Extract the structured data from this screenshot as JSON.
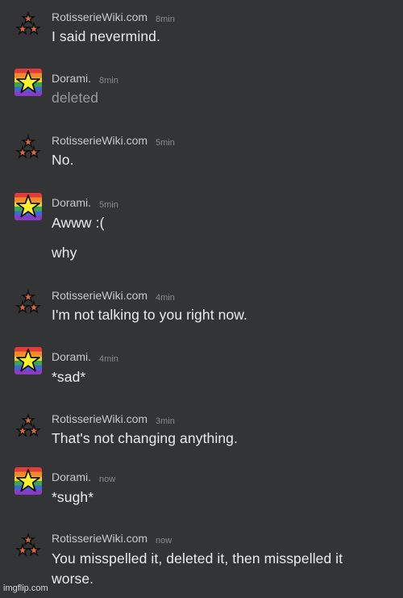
{
  "messages": [
    {
      "author": "RotisserieWiki.com",
      "avatar": "rotisserie-triple-star-avatar",
      "time": "8min",
      "lines": [
        "I said nevermind."
      ]
    },
    {
      "author": "Dorami.",
      "avatar": "rainbow-star-avatar",
      "time": "8min",
      "lines": [
        "deleted"
      ],
      "deleted": true
    },
    {
      "author": "RotisserieWiki.com",
      "avatar": "rotisserie-triple-star-avatar",
      "time": "5min",
      "lines": [
        "No."
      ]
    },
    {
      "author": "Dorami.",
      "avatar": "rainbow-star-avatar",
      "time": "5min",
      "lines": [
        "Awww :(",
        "why"
      ]
    },
    {
      "author": "RotisserieWiki.com",
      "avatar": "rotisserie-triple-star-avatar",
      "time": "4min",
      "lines": [
        "I'm not talking to you right now."
      ]
    },
    {
      "author": "Dorami.",
      "avatar": "rainbow-star-avatar",
      "time": "4min",
      "lines": [
        "*sad*"
      ]
    },
    {
      "author": "RotisserieWiki.com",
      "avatar": "rotisserie-triple-star-avatar",
      "time": "3min",
      "lines": [
        "That's not changing anything."
      ]
    },
    {
      "author": "Dorami.",
      "avatar": "rainbow-star-avatar",
      "time": "now",
      "lines": [
        "*sugh*"
      ]
    },
    {
      "author": "RotisserieWiki.com",
      "avatar": "rotisserie-triple-star-avatar",
      "time": "now",
      "lines": [
        "You misspelled it, deleted it, then misspelled it",
        "worse."
      ]
    }
  ],
  "watermark": "imgflip.com",
  "colors": {
    "background": "#333436",
    "name": "#c9c9c9",
    "timestamp": "#8a8a8a",
    "message": "#ececec",
    "deleted": "#9a9a9a"
  }
}
